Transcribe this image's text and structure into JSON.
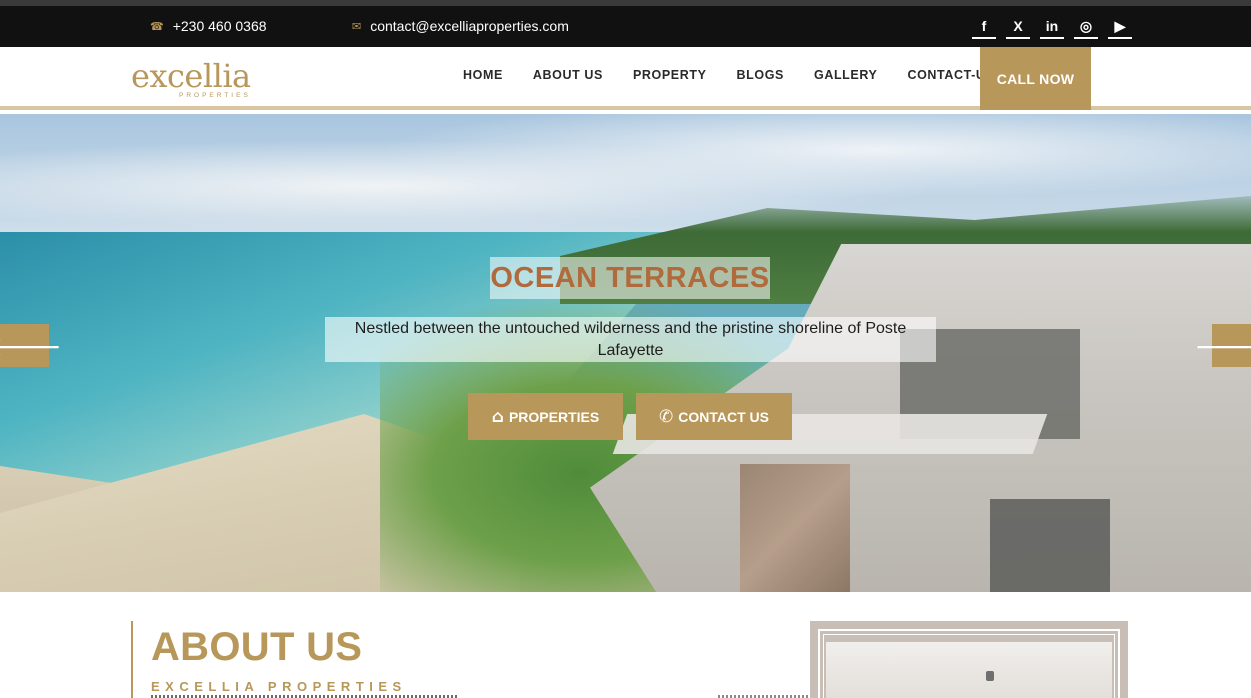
{
  "topbar": {
    "phone": "+230 460 0368",
    "email": "contact@excelliaproperties.com",
    "phone_icon": "phone-icon",
    "email_icon": "envelope-icon",
    "social": [
      {
        "name": "facebook-icon",
        "glyph": "f"
      },
      {
        "name": "x-twitter-icon",
        "glyph": "X"
      },
      {
        "name": "linkedin-icon",
        "glyph": "in"
      },
      {
        "name": "instagram-icon",
        "glyph": "◎"
      },
      {
        "name": "youtube-icon",
        "glyph": "▶"
      }
    ]
  },
  "logo": {
    "word": "excellia",
    "sub": "PROPERTIES"
  },
  "nav": {
    "items": [
      "HOME",
      "ABOUT US",
      "PROPERTY",
      "BLOGS",
      "GALLERY",
      "CONTACT-US"
    ],
    "call_now": "CALL NOW"
  },
  "hero": {
    "title": "OCEAN TERRACES",
    "description": "Nestled between the untouched wilderness and the pristine shoreline of Poste Lafayette",
    "buttons": {
      "properties": "PROPERTIES",
      "contact": "CONTACT US"
    },
    "arrow_left": "🡐",
    "arrow_right": "🡒"
  },
  "about": {
    "title": "ABOUT US",
    "subtitle": "EXCELLIA PROPERTIES"
  },
  "colors": {
    "accent": "#b8975a",
    "topbar_bg": "#111111",
    "title_color": "#b06a3b"
  }
}
